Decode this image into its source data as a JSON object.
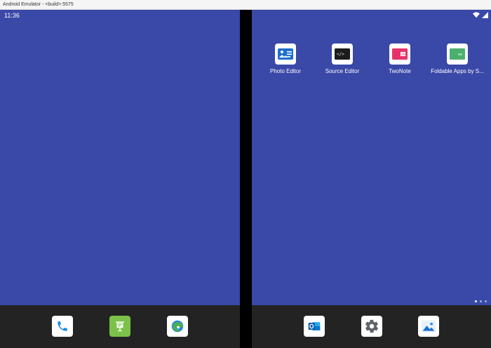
{
  "window": {
    "title": "Android Emulator - <build>:5575"
  },
  "status_bar": {
    "time": "11:36",
    "icons": [
      "wifi-icon",
      "signal-icon"
    ]
  },
  "home_apps": [
    {
      "label": "Photo Editor",
      "icon": "photo-editor-icon"
    },
    {
      "label": "Source Editor",
      "icon": "source-editor-icon"
    },
    {
      "label": "TwoNote",
      "icon": "twonote-icon"
    },
    {
      "label": "Foldable Apps by S...",
      "icon": "foldable-apps-icon"
    }
  ],
  "left_dock": [
    "phone-icon",
    "presentation-icon",
    "edge-browser-icon"
  ],
  "right_dock": [
    "outlook-icon",
    "settings-gear-icon",
    "gallery-icon"
  ],
  "page_indicator": {
    "count": 3,
    "active": 0
  },
  "colors": {
    "wallpaper": "#3a48a8",
    "dock": "#232323",
    "hinge": "#000000",
    "twonote_pink": "#e8336a",
    "foldable_green": "#4caf6e",
    "photo_blue": "#1e6fd0",
    "edge_blue": "#1e88e5",
    "edge_green": "#4caf50"
  }
}
